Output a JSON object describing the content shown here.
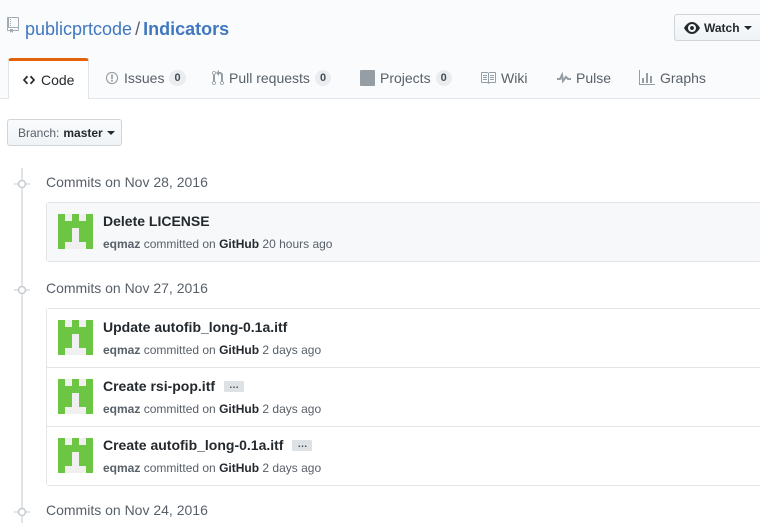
{
  "repo": {
    "owner": "publicprtcode",
    "separator": "/",
    "name": "Indicators",
    "icon": "repo-icon"
  },
  "watch": {
    "label": "Watch",
    "icon": "eye-icon"
  },
  "tabs": [
    {
      "label": "Code",
      "icon": "code-icon",
      "selected": true
    },
    {
      "label": "Issues",
      "icon": "issue-icon",
      "count": "0"
    },
    {
      "label": "Pull requests",
      "icon": "git-pull-request-icon",
      "count": "0"
    },
    {
      "label": "Projects",
      "icon": "project-icon",
      "count": "0"
    },
    {
      "label": "Wiki",
      "icon": "book-icon"
    },
    {
      "label": "Pulse",
      "icon": "pulse-icon"
    },
    {
      "label": "Graphs",
      "icon": "graph-icon"
    }
  ],
  "branch": {
    "prefix": "Branch:",
    "name": "master"
  },
  "groups": [
    {
      "date": "Commits on Nov 28, 2016",
      "commits": [
        {
          "title": "Delete LICENSE",
          "author": "eqmaz",
          "action": "committed on",
          "via": "GitHub",
          "time": "20 hours ago",
          "expandable": false
        }
      ]
    },
    {
      "date": "Commits on Nov 27, 2016",
      "commits": [
        {
          "title": "Update autofib_long-0.1a.itf",
          "author": "eqmaz",
          "action": "committed on",
          "via": "GitHub",
          "time": "2 days ago",
          "expandable": false
        },
        {
          "title": "Create rsi-pop.itf",
          "author": "eqmaz",
          "action": "committed on",
          "via": "GitHub",
          "time": "2 days ago",
          "expandable": true,
          "expand_label": "…"
        },
        {
          "title": "Create autofib_long-0.1a.itf",
          "author": "eqmaz",
          "action": "committed on",
          "via": "GitHub",
          "time": "2 days ago",
          "expandable": true,
          "expand_label": "…"
        }
      ]
    },
    {
      "date": "Commits on Nov 24, 2016",
      "commits": []
    }
  ],
  "colors": {
    "link": "#4078c0",
    "selected_tab_accent": "#e36209",
    "avatar": "#6cc644"
  }
}
